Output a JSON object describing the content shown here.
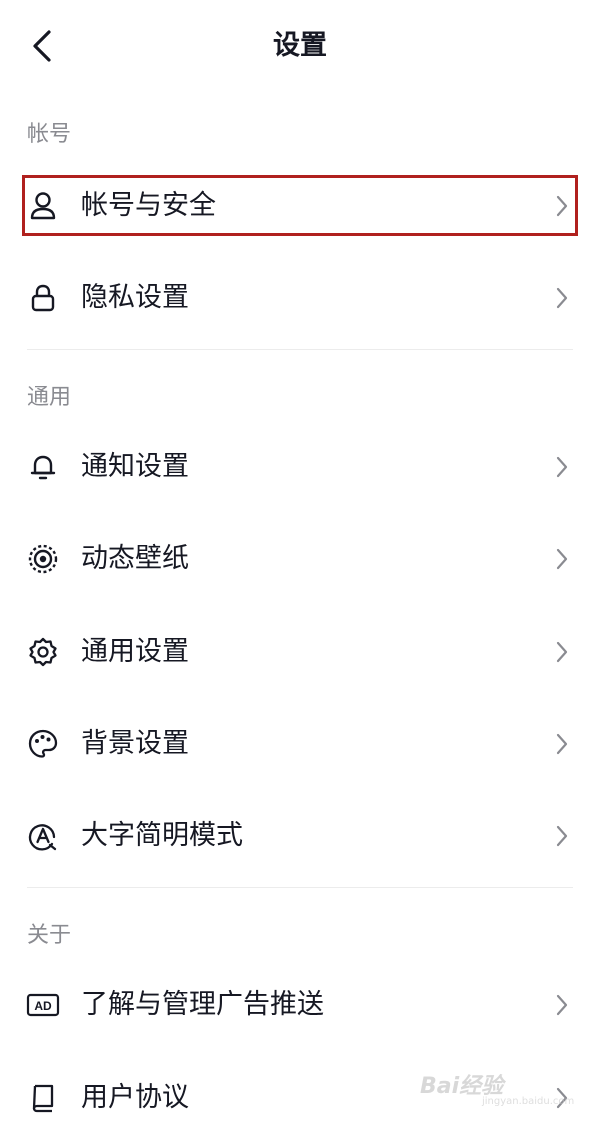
{
  "header": {
    "title": "设置",
    "back_icon": "chevron-left-icon"
  },
  "sections": {
    "account": "帐号",
    "general": "通用",
    "about": "关于"
  },
  "items": {
    "account_security": {
      "label": "帐号与安全",
      "icon": "user-icon"
    },
    "privacy": {
      "label": "隐私设置",
      "icon": "lock-icon"
    },
    "notifications": {
      "label": "通知设置",
      "icon": "bell-icon"
    },
    "live_wallpaper": {
      "label": "动态壁纸",
      "icon": "wallpaper-ring-icon"
    },
    "general_settings": {
      "label": "通用设置",
      "icon": "gear-icon"
    },
    "background": {
      "label": "背景设置",
      "icon": "palette-icon"
    },
    "large_text": {
      "label": "大字简明模式",
      "icon": "letter-a-icon"
    },
    "ads": {
      "label": "了解与管理广告推送",
      "icon": "ad-badge-icon"
    },
    "user_agreement": {
      "label": "用户协议",
      "icon": "book-icon"
    }
  },
  "colors": {
    "highlight_border": "#b0201e",
    "text_primary": "#161823",
    "text_secondary": "#8a8b91"
  },
  "watermark": {
    "brand": "Bai经验",
    "url": "jingyan.baidu.com"
  }
}
